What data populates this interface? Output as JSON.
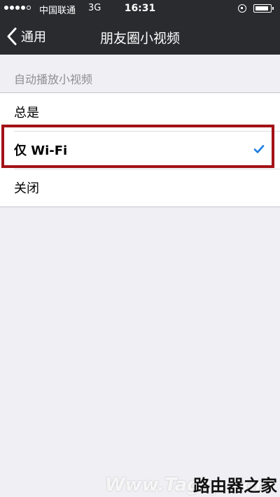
{
  "status_bar": {
    "carrier": "中国联通",
    "network": "3G",
    "time": "16:31",
    "signal_bars": 4,
    "signal_max": 5
  },
  "nav": {
    "back_label": "通用",
    "title": "朋友圈小视频"
  },
  "section": {
    "header": "自动播放小视频",
    "options": [
      {
        "label": "总是",
        "selected": false
      },
      {
        "label": "仅 Wi-Fi",
        "selected": true
      },
      {
        "label": "关闭",
        "selected": false
      }
    ]
  },
  "colors": {
    "nav_background": "#2a2b2f",
    "page_background": "#efeff4",
    "checkmark": "#1a7de0",
    "highlight_border": "#a31217"
  },
  "watermark": {
    "primary": "路由器之家",
    "secondary": "Www.Tagxp.com"
  }
}
